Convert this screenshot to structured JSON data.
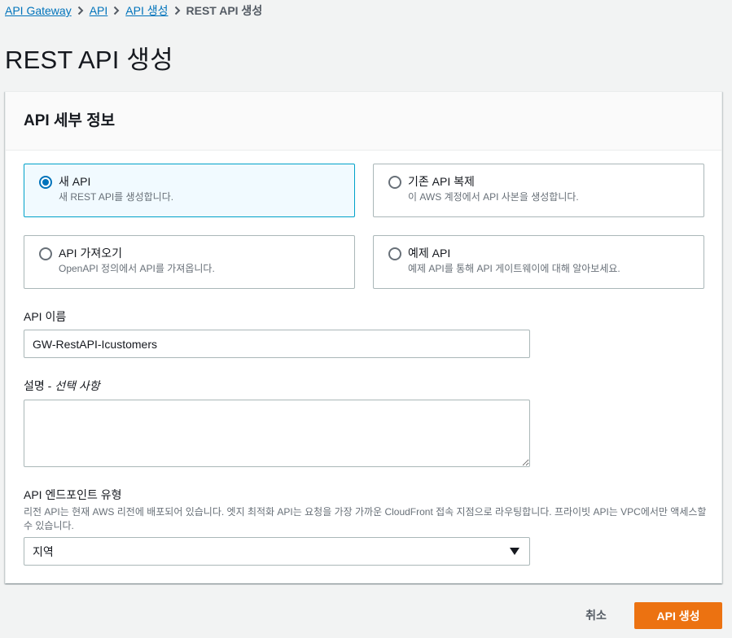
{
  "breadcrumb": {
    "items": [
      "API Gateway",
      "API",
      "API 생성"
    ],
    "current": "REST API 생성"
  },
  "page_title": "REST API 생성",
  "panel": {
    "title": "API 세부 정보",
    "options": [
      {
        "title": "새 API",
        "desc": "새 REST API를 생성합니다.",
        "selected": true
      },
      {
        "title": "기존 API 복제",
        "desc": "이 AWS 계정에서 API 사본을 생성합니다.",
        "selected": false
      },
      {
        "title": "API 가져오기",
        "desc": "OpenAPI 정의에서 API를 가져옵니다.",
        "selected": false
      },
      {
        "title": "예제 API",
        "desc": "예제 API를 통해 API 게이트웨이에 대해 알아보세요.",
        "selected": false
      }
    ],
    "api_name": {
      "label": "API 이름",
      "value": "GW-RestAPI-Icustomers"
    },
    "description": {
      "label": "설명 - ",
      "label_optional": "선택 사항",
      "value": ""
    },
    "endpoint": {
      "label": "API 엔드포인트 유형",
      "desc": "리전 API는 현재 AWS 리전에 배포되어 있습니다. 엣지 최적화 API는 요청을 가장 가까운 CloudFront 접속 지점으로 라우팅합니다. 프라이빗 API는 VPC에서만 액세스할 수 있습니다.",
      "selected": "지역"
    }
  },
  "actions": {
    "cancel": "취소",
    "create": "API 생성"
  },
  "colors": {
    "link": "#0073bb",
    "primary": "#ec7211",
    "selected_border": "#00a1c9",
    "selected_bg": "#f1faff"
  }
}
